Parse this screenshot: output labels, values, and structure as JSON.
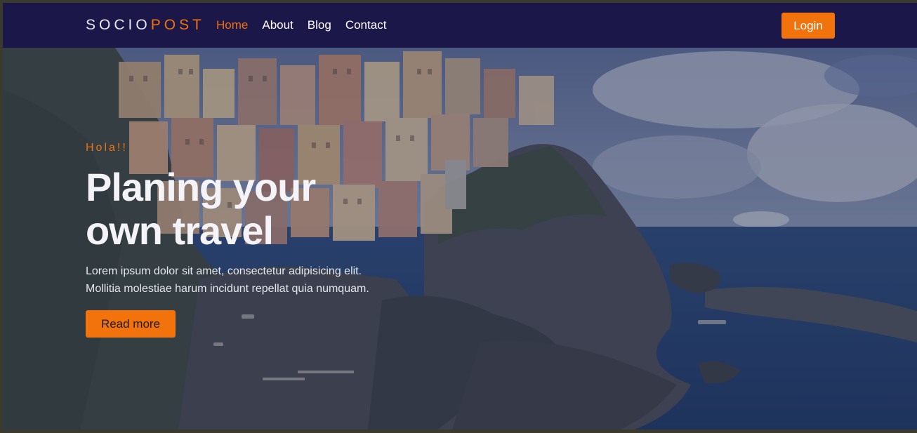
{
  "brand": {
    "part1": "SOCIO",
    "part2": "POST"
  },
  "nav": {
    "items": [
      {
        "label": "Home",
        "active": true
      },
      {
        "label": "About",
        "active": false
      },
      {
        "label": "Blog",
        "active": false
      },
      {
        "label": "Contact",
        "active": false
      }
    ],
    "login_label": "Login"
  },
  "hero": {
    "kicker": "Hola!!",
    "title": "Planing your own travel",
    "description_line1": "Lorem ipsum dolor sit amet, consectetur adipisicing elit.",
    "description_line2": "Mollitia molestiae harum incidunt repellat quia numquam.",
    "button_label": "Read more",
    "image_alt": "cliffside coastal village"
  },
  "colors": {
    "navbar": "#1c1749",
    "accent": "#f2720c",
    "text_light": "#ffffff"
  }
}
